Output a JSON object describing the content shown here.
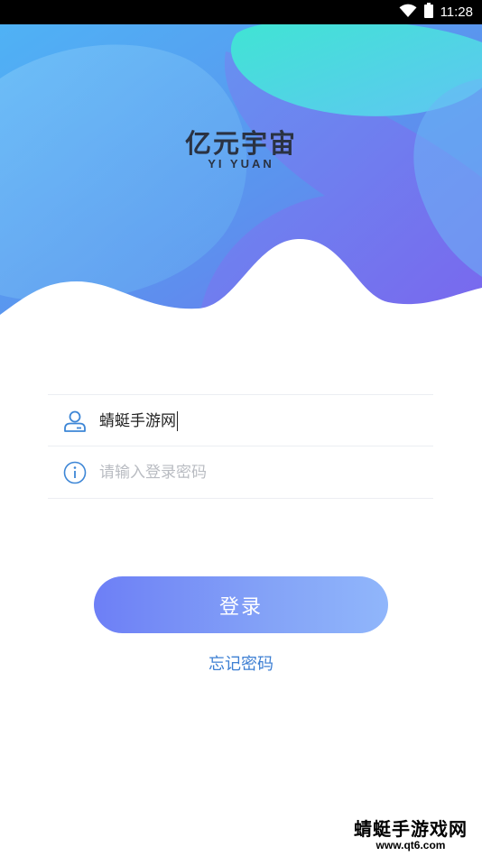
{
  "status_bar": {
    "time": "11:28",
    "icons": [
      "wifi-icon",
      "battery-icon"
    ]
  },
  "header": {
    "logo_title": "亿元宇宙",
    "logo_subtitle": "YI YUAN"
  },
  "form": {
    "username": {
      "value": "蜻蜓手游网",
      "icon": "user-icon"
    },
    "password": {
      "value": "",
      "placeholder": "请输入登录密码",
      "icon": "info-icon"
    },
    "login_label": "登录",
    "forgot_label": "忘记密码"
  },
  "watermark": {
    "title": "蜻蜓手游戏网",
    "url": "www.qt6.com"
  },
  "colors": {
    "accent": "#3d7fd3",
    "button_start": "#6d7ff6",
    "button_end": "#90b6fb",
    "hero_blue": "#5aa9f0",
    "hero_purple": "#7a6ff0",
    "hero_teal": "#4fe6d6"
  }
}
